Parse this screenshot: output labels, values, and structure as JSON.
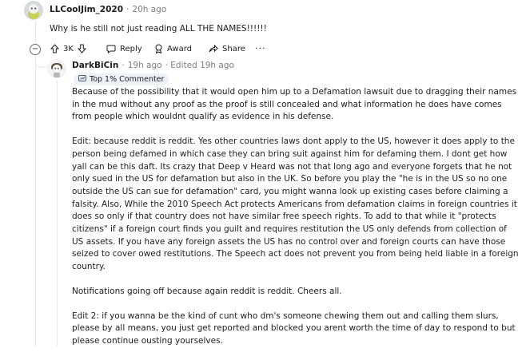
{
  "parent_comment": {
    "author": "LLCoolJim_2020",
    "separator": "·",
    "time": "20h ago",
    "text": "Why is he still not just reading ALL THE NAMES!!!!!!",
    "actions": {
      "votes": "3K",
      "reply": "Reply",
      "award": "Award",
      "share": "Share",
      "more": "···"
    },
    "collapse_symbol": "−"
  },
  "reply_comment": {
    "author": "DarkBiCin",
    "separator": "·",
    "time": "19h ago",
    "edited": "· Edited 19h ago",
    "badge": "Top 1% Commenter",
    "paragraphs": [
      "Because of the possibility that it would open him up to a Defamation lawsuit due to dragging their names in the mud without any proof as the proof is still concealed and what information he does have comes from people which wouldnt qualify as evidence in his defense.",
      "Edit: because reddit is reddit. Yes other countries laws dont apply to the US, however it does apply to the person being defamed in which case they can bring suit against him for defaming them. I dont get how yall can be this daft. Its crazy that Deep v Heard was not that long ago and everyone forgets that he not only sued in the US for defamation but also in the UK. So before you play the \"he is in the US so no one outside the US can sue for defamation\" card, you might wanna look up existing cases before claiming a falsity. Also, While the 2010 Speech Act protects Americans from defamation claims in foreign countries it does so only if that country does not have similar free speech rights. To add to that while it \"protects citizens\" if a foreign court finds you guilt and requires restitution the US only defends from collection of US assets. If you have any foreign assets the US has no control over and foreign courts can have those seized to cover owed restitutions. The Speech act does not prevent you from being held liable in a foreign country.",
      "Notifications going off because again reddit is reddit. Cheers all.",
      "Edit 2: if you wanna be the kind of cunt who dm's someone chewing them out and calling them slurs, please by all means, you just get reported and blocked you arent worth the time of day to respond to but please continue ousting yourselves."
    ]
  },
  "colors": {
    "accent_orange": "#ff4500",
    "badge_bg": "#eef1f6",
    "meta_text": "#7c7c7c",
    "thread_line": "#e4e6e8"
  }
}
